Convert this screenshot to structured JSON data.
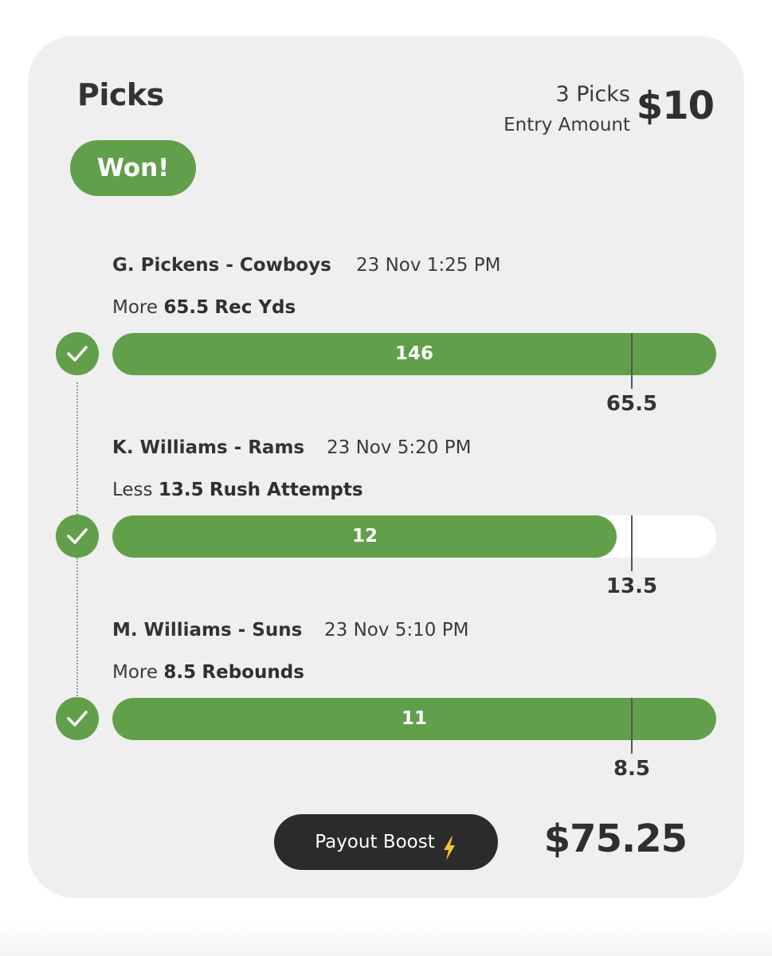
{
  "header": {
    "title": "Picks",
    "picks_count": "3 Picks",
    "entry_label": "Entry Amount",
    "entry_amount": "$10"
  },
  "status_badge": "Won!",
  "picks": [
    {
      "player": "G. Pickens - Cowboys",
      "time": "23 Nov 1:25 PM",
      "direction": "More",
      "target": "65.5",
      "stat": "Rec Yds",
      "result": "146",
      "threshold": "65.5",
      "progress": 1.0,
      "threshold_fraction": 0.86,
      "status": "won"
    },
    {
      "player": "K. Williams - Rams",
      "time": "23 Nov 5:20 PM",
      "direction": "Less",
      "target": "13.5",
      "stat": "Rush Attempts",
      "result": "12",
      "threshold": "13.5",
      "progress": 0.835,
      "threshold_fraction": 0.86,
      "status": "won"
    },
    {
      "player": "M. Williams - Suns",
      "time": "23 Nov 5:10 PM",
      "direction": "More",
      "target": "8.5",
      "stat": "Rebounds",
      "result": "11",
      "threshold": "8.5",
      "progress": 1.0,
      "threshold_fraction": 0.86,
      "status": "won"
    }
  ],
  "footer": {
    "boost_label": "Payout Boost",
    "boost_icon": "lightning-bolt-icon",
    "payout": "$75.25"
  },
  "colors": {
    "accent_green": "#629f4a",
    "card_background": "#efefef",
    "boost_button": "#2b2b2b",
    "bolt": "#f2c12e"
  }
}
